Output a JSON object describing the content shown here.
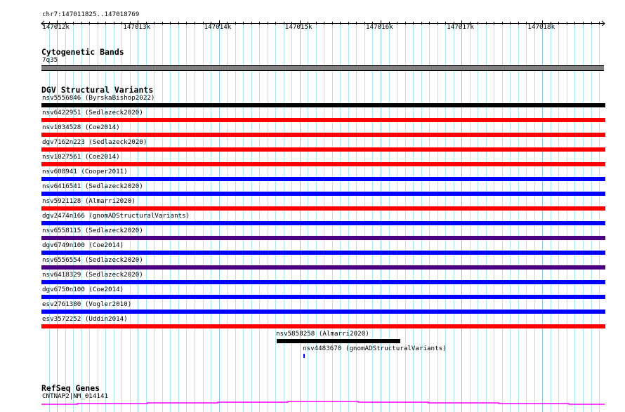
{
  "region": "chr7:147011825..147018769",
  "region_start": 147011825,
  "region_end": 147018769,
  "ruler_ticks": [
    "147012k",
    "147013k",
    "147014k",
    "147015k",
    "147016k",
    "147017k",
    "147018k"
  ],
  "cytoband": {
    "title": "Cytogenetic Bands",
    "band": "7q35",
    "color": "#808080"
  },
  "dgv": {
    "title": "DGV Structural Variants",
    "full_rows": [
      {
        "label": "nsv5556846 (ByrskaBishop2022)",
        "color": "#000000"
      },
      {
        "label": "nsv6422951 (Sedlazeck2020)",
        "color": "#ff0000"
      },
      {
        "label": "nsv1034528 (Coe2014)",
        "color": "#ff0000"
      },
      {
        "label": "dgv7162n223 (Sedlazeck2020)",
        "color": "#ff0000"
      },
      {
        "label": "nsv1027561 (Coe2014)",
        "color": "#ff0000"
      },
      {
        "label": "nsv608941 (Cooper2011)",
        "color": "#0000ff"
      },
      {
        "label": "nsv6416541 (Sedlazeck2020)",
        "color": "#0000ff"
      },
      {
        "label": "nsv5921128 (Almarri2020)",
        "color": "#ff0000"
      },
      {
        "label": "dgv2474n166 (gnomADStructuralVariants)",
        "color": "#0000ff"
      },
      {
        "label": "nsv6558115 (Sedlazeck2020)",
        "color": "#4b0082"
      },
      {
        "label": "dgv6749n100 (Coe2014)",
        "color": "#0000ff"
      },
      {
        "label": "nsv6556554 (Sedlazeck2020)",
        "color": "#4b0082"
      },
      {
        "label": "nsv6418329 (Sedlazeck2020)",
        "color": "#0000ff"
      },
      {
        "label": "dgv6750n100 (Coe2014)",
        "color": "#0000ff"
      },
      {
        "label": "esv2761380 (Vogler2010)",
        "color": "#0000ff"
      },
      {
        "label": "esv3572252 (Uddin2014)",
        "color": "#ff0000"
      }
    ],
    "partial_rows": [
      {
        "label": "nsv5858258 (Almarri2020)",
        "color": "#000000"
      },
      {
        "label": "nsv4483670 (gnomADStructuralVariants)",
        "color": "#0000ff"
      }
    ]
  },
  "refseq": {
    "title": "RefSeq Genes",
    "gene": "CNTNAP2|NM_014141",
    "color": "#ff00ff"
  }
}
